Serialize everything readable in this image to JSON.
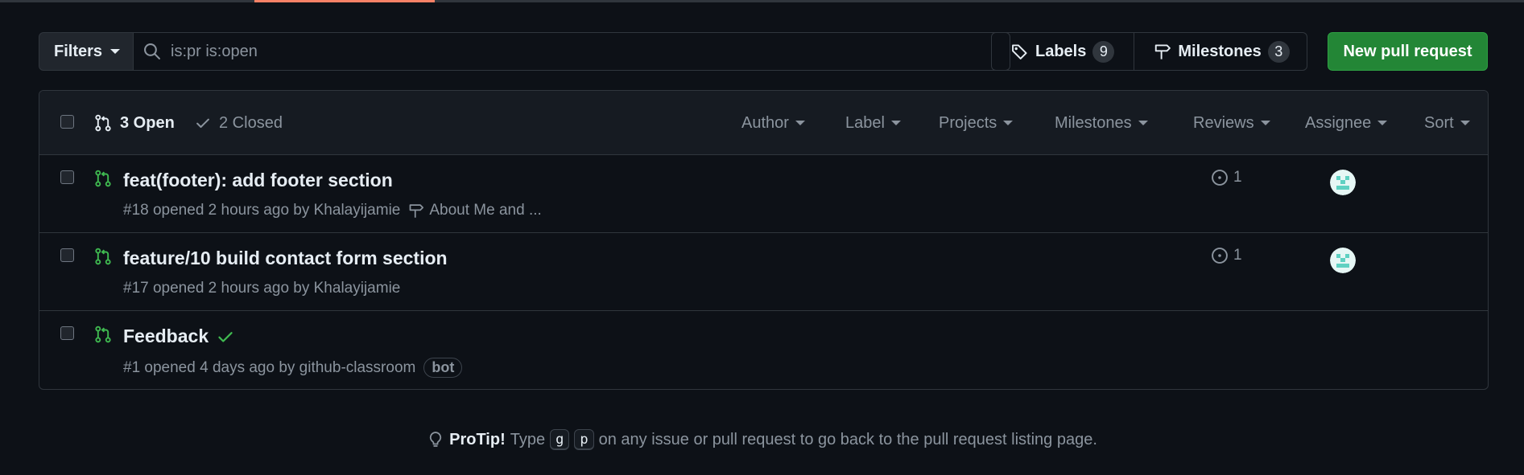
{
  "toolbar": {
    "filters_label": "Filters",
    "search_value": "is:pr is:open",
    "labels_label": "Labels",
    "labels_count": "9",
    "milestones_label": "Milestones",
    "milestones_count": "3",
    "new_pr_label": "New pull request"
  },
  "list_header": {
    "open_label": "3 Open",
    "closed_label": "2 Closed",
    "filters": [
      "Author",
      "Label",
      "Projects",
      "Milestones",
      "Reviews",
      "Assignee",
      "Sort"
    ]
  },
  "pull_requests": [
    {
      "title": "feat(footer): add footer section",
      "meta": "#18 opened 2 hours ago by Khalayijamie",
      "milestone": "About Me and ...",
      "comments": "1",
      "has_assignee": true,
      "status_check": false
    },
    {
      "title": "feature/10 build contact form section",
      "meta": "#17 opened 2 hours ago by Khalayijamie",
      "milestone": "",
      "comments": "1",
      "has_assignee": true,
      "status_check": false
    },
    {
      "title": "Feedback",
      "meta": "#1 opened 4 days ago by github-classroom",
      "badge": "bot",
      "milestone": "",
      "comments": "",
      "has_assignee": false,
      "status_check": true
    }
  ],
  "protip": {
    "title": "ProTip!",
    "before": "Type",
    "key1": "g",
    "key2": "p",
    "after": "on any issue or pull request to go back to the pull request listing page."
  },
  "colors": {
    "background": "#0d1117",
    "open_green": "#3fb950",
    "primary_button": "#238636",
    "tab_accent": "#f78166"
  }
}
